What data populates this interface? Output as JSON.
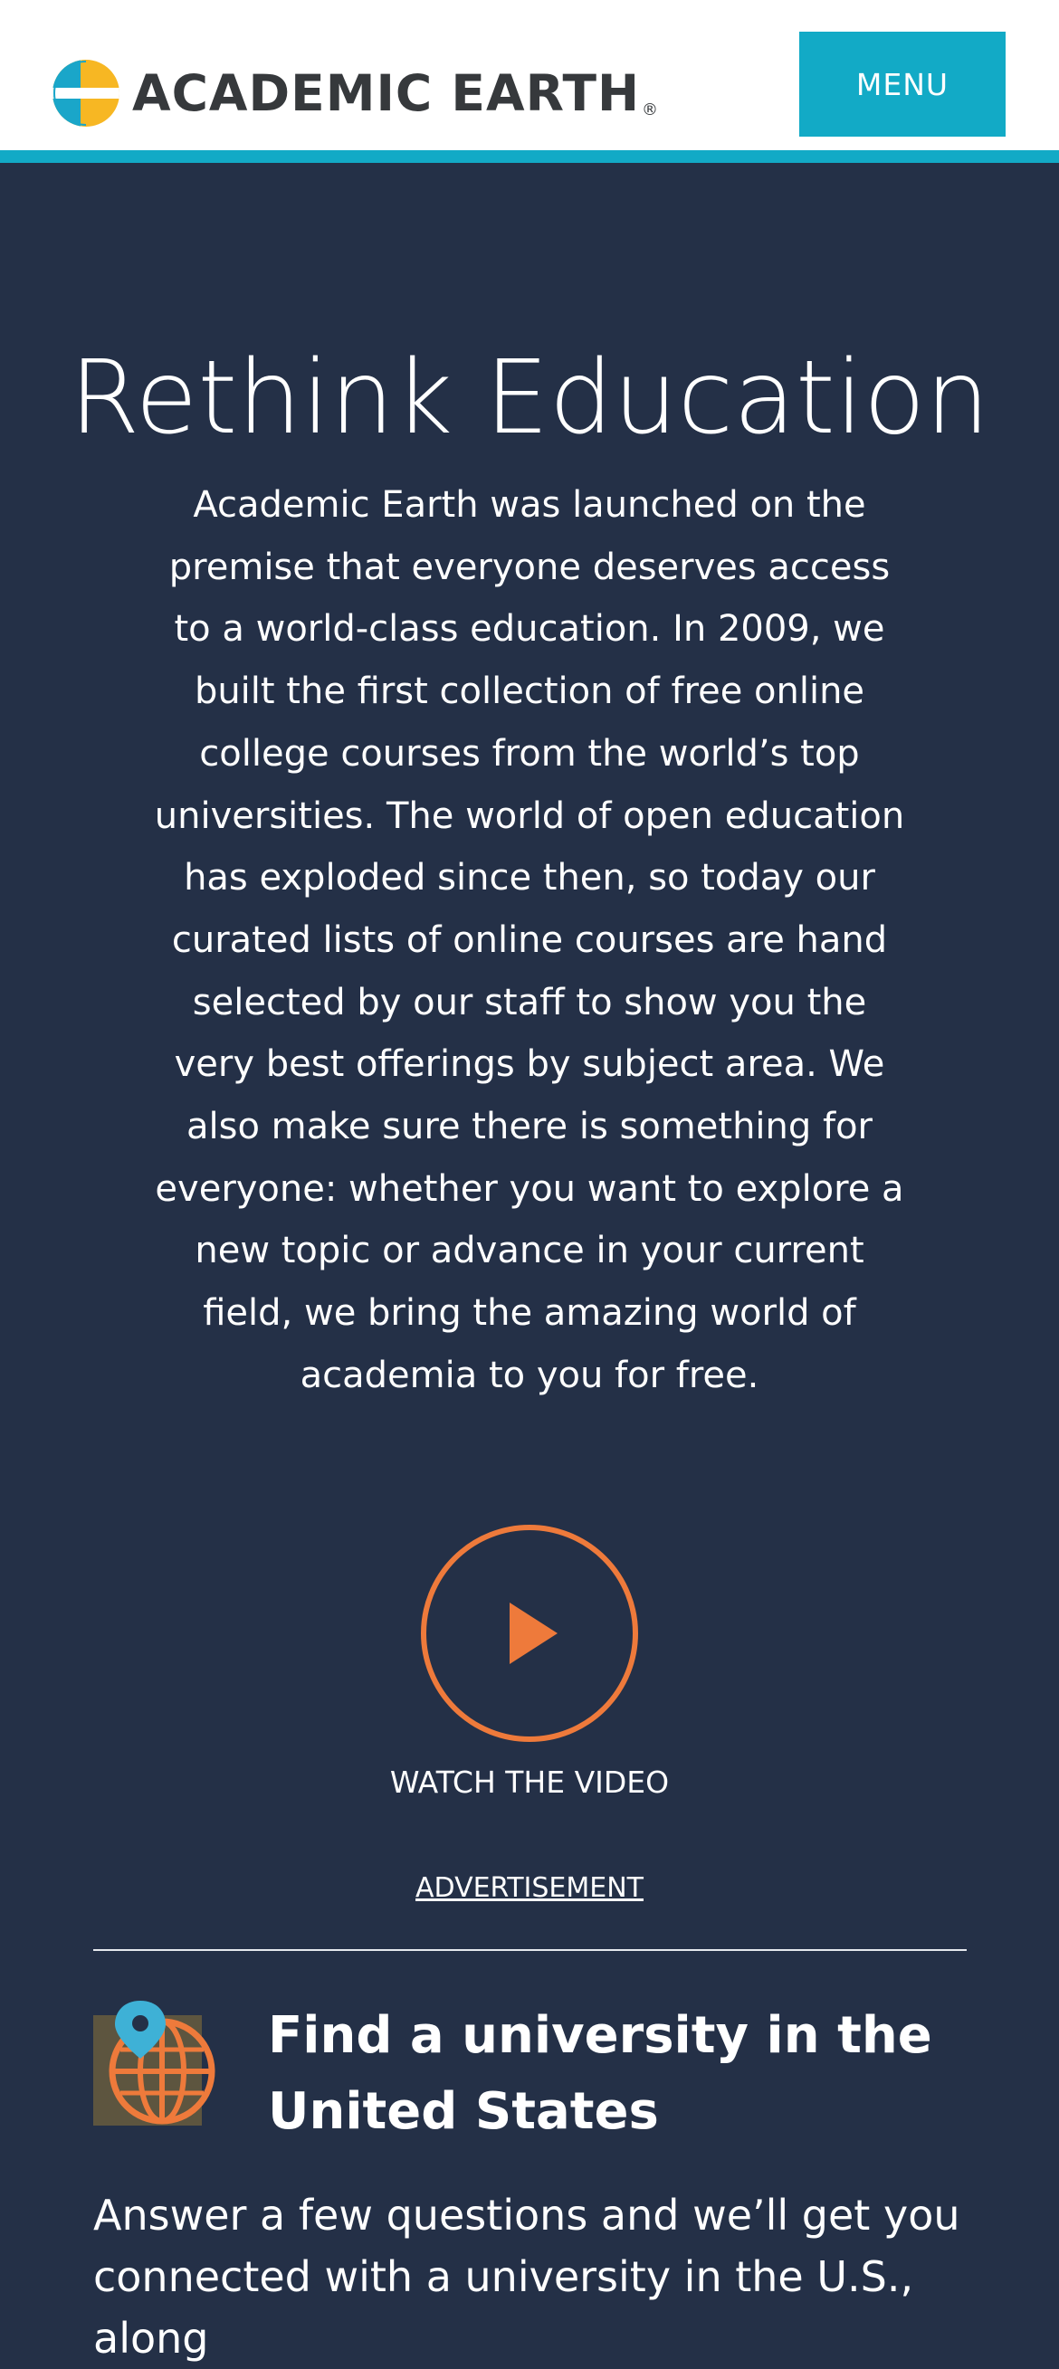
{
  "header": {
    "logo_text": "ACADEMIC EARTH",
    "logo_registered": "®",
    "menu_label": "MENU"
  },
  "hero": {
    "title": "Rethink Education",
    "description": "Academic Earth was launched on the premise that everyone deserves access to a world-class education. In 2009, we built the first collection of free online college courses from the world’s top universities. The world of open education has exploded since then, so today our curated lists of online courses are hand selected by our staff to show you the very best offerings by subject area. We also make sure there is something for everyone: whether you want to explore a new topic or advance in your current field, we bring the amazing world of academia to you for free.",
    "watch_label": "WATCH THE VIDEO"
  },
  "advertisement_label": "ADVERTISEMENT",
  "university_finder": {
    "title": "Find a university in the United States",
    "description": "Answer a few questions and we’ll get you connected with a university in the U.S., along"
  },
  "colors": {
    "background": "#243047",
    "accent": "#12aac6",
    "play": "#ee7a3b",
    "logo_yellow": "#f7b723",
    "logo_blue": "#1aa6c9"
  },
  "icons": {
    "logo": "academic-earth-logo-icon",
    "play": "play-circle-icon",
    "globe": "globe-location-icon"
  }
}
